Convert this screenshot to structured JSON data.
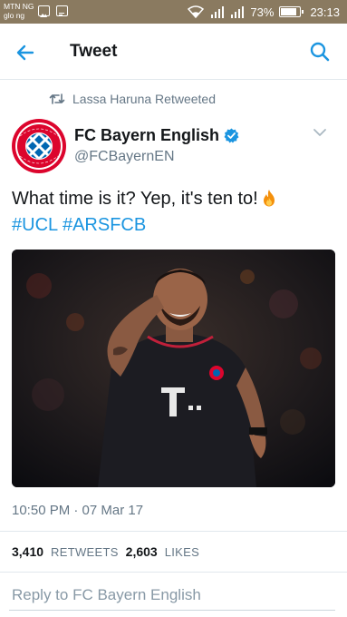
{
  "status_bar": {
    "carrier_line1": "MTN NG",
    "carrier_line2": "glo ng",
    "battery": "73%",
    "battery_level": 0.73,
    "time": "23:13"
  },
  "app_bar": {
    "title": "Tweet",
    "back_icon": "arrow-left-icon",
    "search_icon": "search-icon"
  },
  "retweet": {
    "text": "Lassa Haruna Retweeted",
    "icon": "retweet-icon"
  },
  "author": {
    "name": "FC Bayern English",
    "handle": "@FCBayernEN",
    "verified": true,
    "avatar": "fc-bayern-logo"
  },
  "tweet": {
    "text": "What time is it? Yep, it's ten to!",
    "emoji": "fire-icon",
    "hashtags": [
      "#UCL",
      "#ARSFCB"
    ],
    "timestamp": "10:50 PM · 07 Mar 17"
  },
  "stats": {
    "retweets_count": "3,410",
    "retweets_label": "RETWEETS",
    "likes_count": "2,603",
    "likes_label": "LIKES"
  },
  "reply": {
    "placeholder": "Reply to FC Bayern English"
  },
  "colors": {
    "accent": "#1b95e0",
    "status_bar": "#8a7a60",
    "secondary_text": "#657786",
    "bayern_red": "#dc052d",
    "bayern_blue": "#0066b2"
  }
}
